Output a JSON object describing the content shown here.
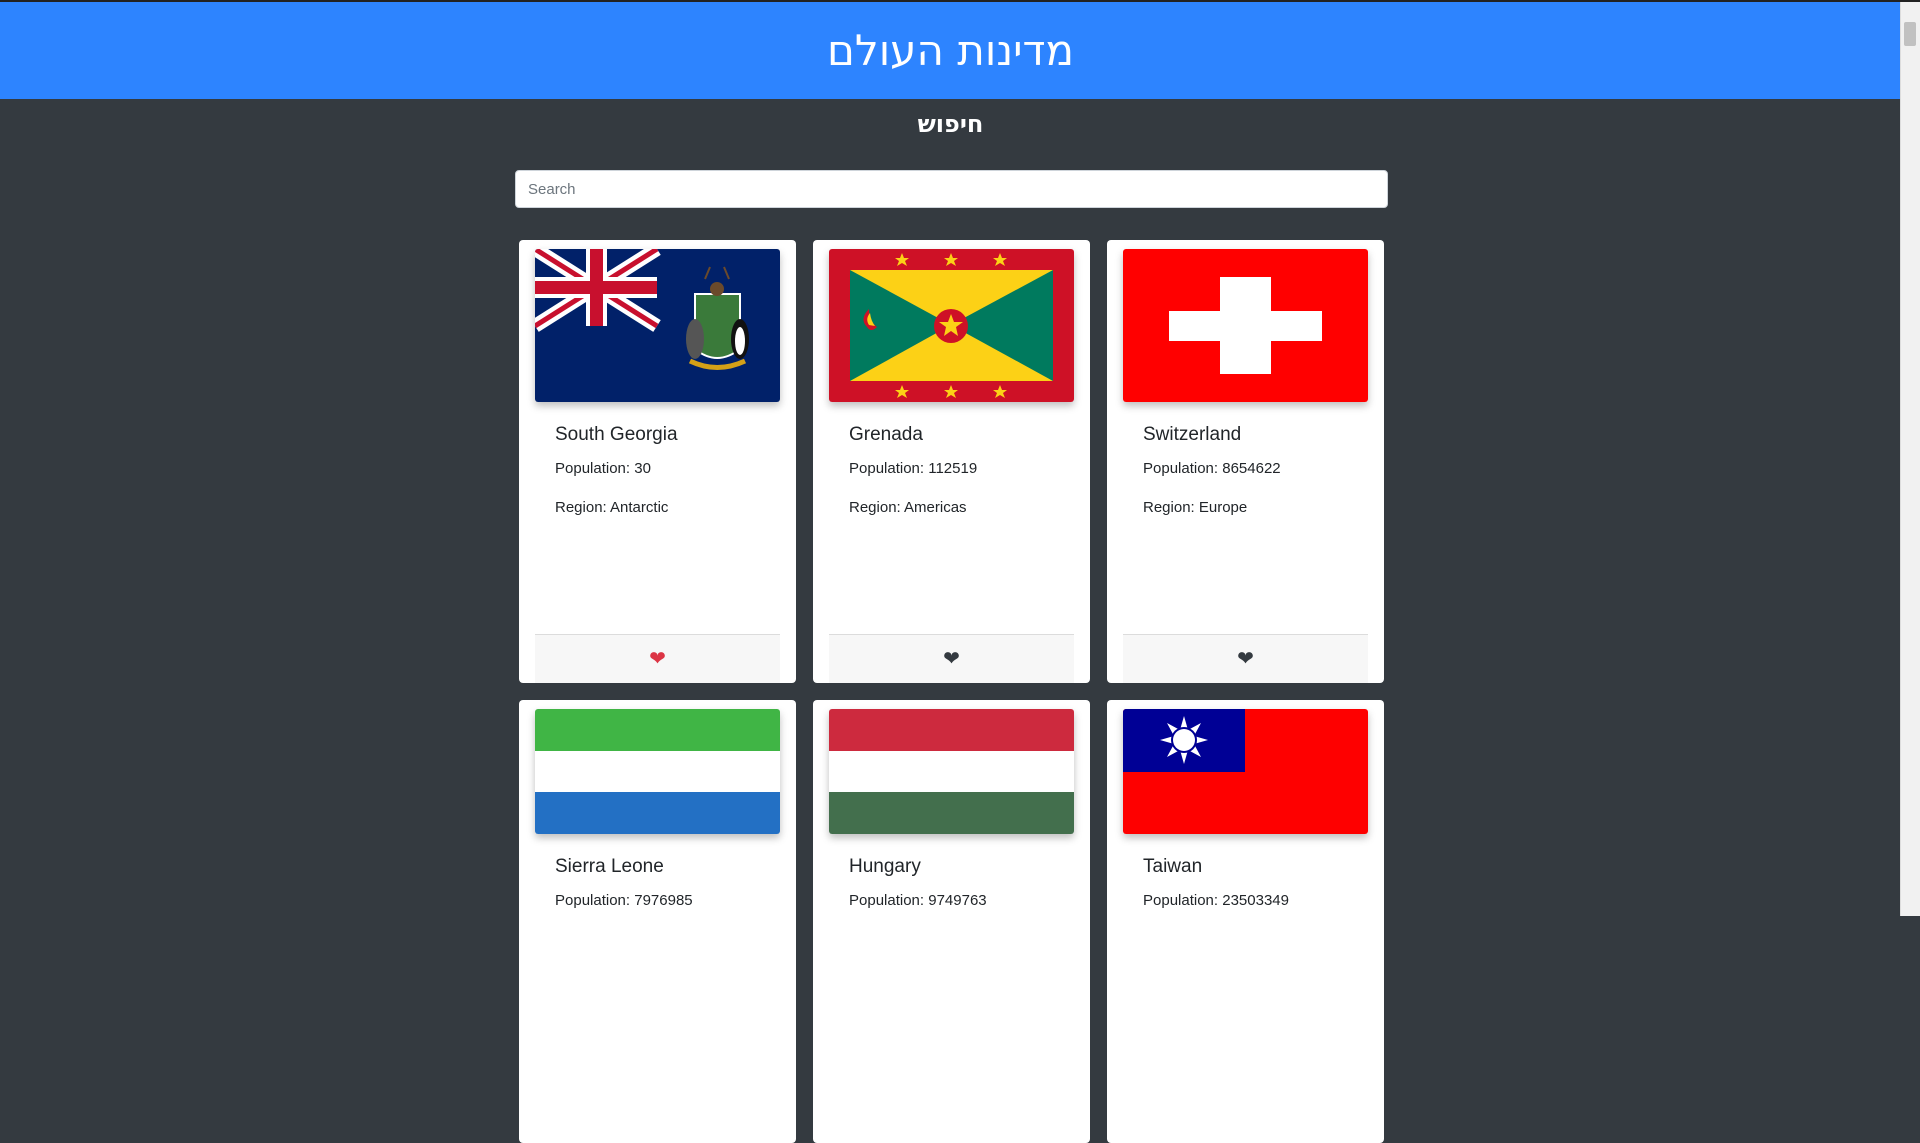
{
  "header": {
    "title": "מדינות העולם"
  },
  "search": {
    "heading": "חיפוש",
    "placeholder": "Search"
  },
  "labels": {
    "population": "Population: ",
    "region": "Region: "
  },
  "colors": {
    "header_bg": "#2d84ff",
    "page_bg": "#343a40",
    "favorite": "#dc3545",
    "not_favorite": "#343a40"
  },
  "countries": [
    {
      "name": "South Georgia",
      "population": "30",
      "region": "Antarctic",
      "favorite": true,
      "flag": "south-georgia-flag"
    },
    {
      "name": "Grenada",
      "population": "112519",
      "region": "Americas",
      "favorite": false,
      "flag": "grenada-flag"
    },
    {
      "name": "Switzerland",
      "population": "8654622",
      "region": "Europe",
      "favorite": false,
      "flag": "switzerland-flag"
    },
    {
      "name": "Sierra Leone",
      "population": "7976985",
      "region": "",
      "favorite": false,
      "flag": "sierra-leone-flag"
    },
    {
      "name": "Hungary",
      "population": "9749763",
      "region": "",
      "favorite": false,
      "flag": "hungary-flag"
    },
    {
      "name": "Taiwan",
      "population": "23503349",
      "region": "",
      "favorite": false,
      "flag": "taiwan-flag"
    }
  ]
}
